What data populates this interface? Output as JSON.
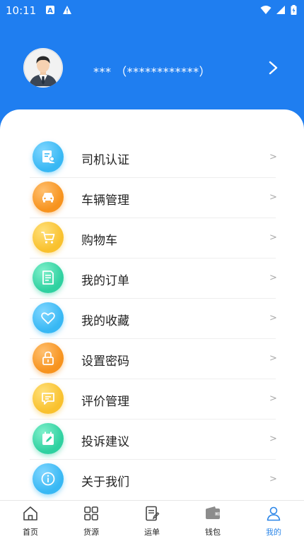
{
  "statusbar": {
    "time": "10:11"
  },
  "profile": {
    "username": "*** （************）"
  },
  "menu": {
    "chevron": ">",
    "items": [
      {
        "label": "司机认证",
        "icon": "driver-certification-icon",
        "color": "#38b8f4"
      },
      {
        "label": "车辆管理",
        "icon": "car-icon",
        "color": "#f7931e"
      },
      {
        "label": "购物车",
        "icon": "shopping-cart-icon",
        "color": "#f9c12e"
      },
      {
        "label": "我的订单",
        "icon": "order-icon",
        "color": "#2fd1a0"
      },
      {
        "label": "我的收藏",
        "icon": "heart-icon",
        "color": "#38b8f4"
      },
      {
        "label": "设置密码",
        "icon": "lock-icon",
        "color": "#f7931e"
      },
      {
        "label": "评价管理",
        "icon": "comment-icon",
        "color": "#f9c12e"
      },
      {
        "label": "投诉建议",
        "icon": "complaint-icon",
        "color": "#2fd1a0"
      },
      {
        "label": "关于我们",
        "icon": "info-icon",
        "color": "#38b8f4"
      }
    ]
  },
  "tabbar": {
    "active_color": "#2c86e8",
    "items": [
      {
        "label": "首页",
        "icon": "home-icon"
      },
      {
        "label": "货源",
        "icon": "grid-icon"
      },
      {
        "label": "运单",
        "icon": "waybill-icon"
      },
      {
        "label": "钱包",
        "icon": "wallet-icon"
      },
      {
        "label": "我的",
        "icon": "user-icon"
      }
    ]
  }
}
